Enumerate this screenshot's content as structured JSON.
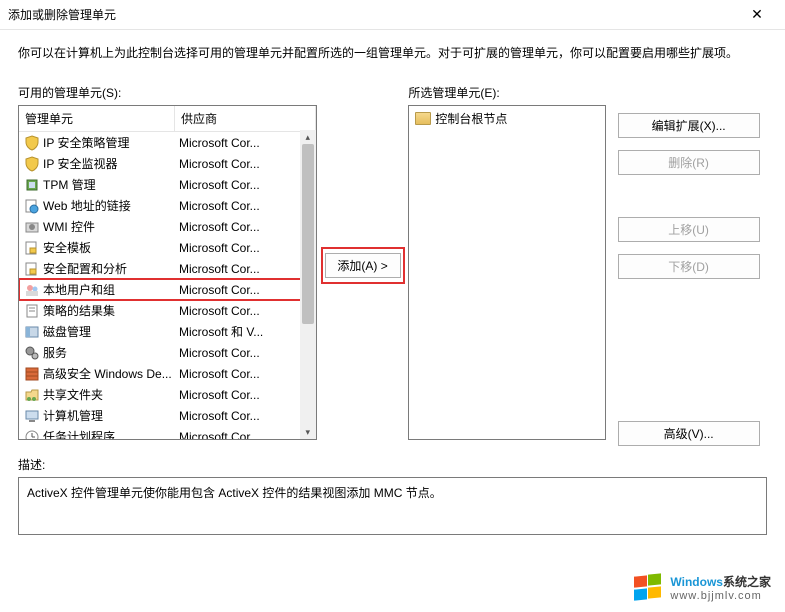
{
  "window": {
    "title": "添加或删除管理单元",
    "close_glyph": "✕"
  },
  "instruction": "你可以在计算机上为此控制台选择可用的管理单元并配置所选的一组管理单元。对于可扩展的管理单元，你可以配置要启用哪些扩展项。",
  "labels": {
    "available": "可用的管理单元(S):",
    "selected": "所选管理单元(E):",
    "col_snapin": "管理单元",
    "col_vendor": "供应商",
    "description": "描述:"
  },
  "available_list": [
    {
      "name": "IP 安全策略管理",
      "vendor": "Microsoft Cor...",
      "icon": "shield-yellow"
    },
    {
      "name": "IP 安全监视器",
      "vendor": "Microsoft Cor...",
      "icon": "shield-yellow"
    },
    {
      "name": "TPM 管理",
      "vendor": "Microsoft Cor...",
      "icon": "chip"
    },
    {
      "name": "Web 地址的链接",
      "vendor": "Microsoft Cor...",
      "icon": "link-page"
    },
    {
      "name": "WMI 控件",
      "vendor": "Microsoft Cor...",
      "icon": "gear-box"
    },
    {
      "name": "安全模板",
      "vendor": "Microsoft Cor...",
      "icon": "lock-page"
    },
    {
      "name": "安全配置和分析",
      "vendor": "Microsoft Cor...",
      "icon": "lock-page"
    },
    {
      "name": "本地用户和组",
      "vendor": "Microsoft Cor...",
      "icon": "users",
      "highlighted": true
    },
    {
      "name": "策略的结果集",
      "vendor": "Microsoft Cor...",
      "icon": "report"
    },
    {
      "name": "磁盘管理",
      "vendor": "Microsoft 和 V...",
      "icon": "disk"
    },
    {
      "name": "服务",
      "vendor": "Microsoft Cor...",
      "icon": "gears"
    },
    {
      "name": "高级安全 Windows De...",
      "vendor": "Microsoft Cor...",
      "icon": "firewall"
    },
    {
      "name": "共享文件夹",
      "vendor": "Microsoft Cor...",
      "icon": "shared-folder"
    },
    {
      "name": "计算机管理",
      "vendor": "Microsoft Cor...",
      "icon": "computer"
    },
    {
      "name": "任务计划程序",
      "vendor": "Microsoft Cor...",
      "icon": "clock"
    }
  ],
  "selected_tree": {
    "root": "控制台根节点"
  },
  "buttons": {
    "add": "添加(A) >",
    "edit_ext": "编辑扩展(X)...",
    "remove": "删除(R)",
    "move_up": "上移(U)",
    "move_down": "下移(D)",
    "advanced": "高级(V)..."
  },
  "description_text": "ActiveX 控件管理单元使你能用包含 ActiveX 控件的结果视图添加 MMC 节点。",
  "watermark": {
    "brand_a": "Windows",
    "brand_b": "系统之家",
    "url": "www.bjjmlv.com"
  }
}
